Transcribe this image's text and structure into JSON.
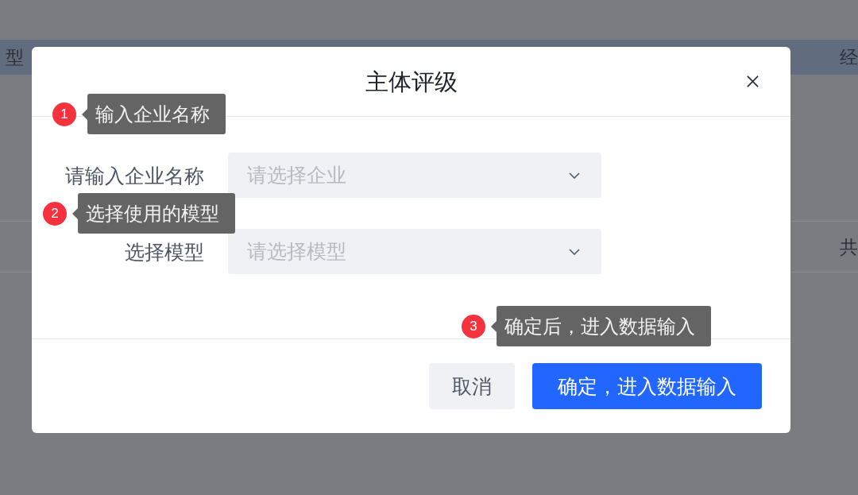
{
  "table": {
    "columns": [
      "型",
      "经"
    ],
    "rows": [
      {
        "cells": [
          "",
          "共"
        ]
      }
    ]
  },
  "dialog": {
    "title": "主体评级",
    "fields": [
      {
        "label": "请输入企业名称",
        "placeholder": "请选择企业"
      },
      {
        "label": "选择模型",
        "placeholder": "请选择模型"
      }
    ],
    "buttons": [
      {
        "label": "取消",
        "kind": "secondary"
      },
      {
        "label": "确定，进入数据输入",
        "kind": "primary"
      }
    ]
  },
  "annotations": [
    {
      "number": "1",
      "text": "输入企业名称"
    },
    {
      "number": "2",
      "text": "选择使用的模型"
    },
    {
      "number": "3",
      "text": "确定后，进入数据输入"
    }
  ]
}
